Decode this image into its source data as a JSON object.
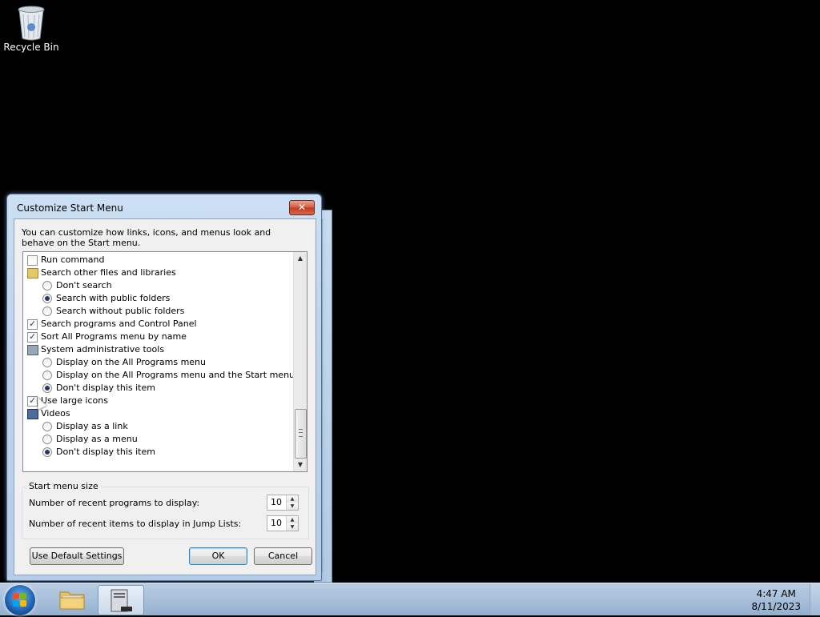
{
  "desktop": {
    "recycle_bin_label": "Recycle Bin"
  },
  "dialog": {
    "title": "Customize Start Menu",
    "close_label": "✕",
    "description": "You can customize how links, icons, and menus look and behave on the Start menu.",
    "items": [
      {
        "kind": "checkbox",
        "label": "Run command",
        "checked": false
      },
      {
        "kind": "group",
        "label": "Search other files and libraries",
        "icon": "folder-search-icon"
      },
      {
        "kind": "radio",
        "label": "Don't search",
        "selected": false
      },
      {
        "kind": "radio",
        "label": "Search with public folders",
        "selected": true
      },
      {
        "kind": "radio",
        "label": "Search without public folders",
        "selected": false
      },
      {
        "kind": "checkbox",
        "label": "Search programs and Control Panel",
        "checked": true
      },
      {
        "kind": "checkbox",
        "label": "Sort All Programs menu by name",
        "checked": true
      },
      {
        "kind": "group",
        "label": "System administrative tools",
        "icon": "admin-tools-icon"
      },
      {
        "kind": "radio",
        "label": "Display on the All Programs menu",
        "selected": false
      },
      {
        "kind": "radio",
        "label": "Display on the All Programs menu and the Start menu",
        "selected": false
      },
      {
        "kind": "radio",
        "label": "Don't display this item",
        "selected": true
      },
      {
        "kind": "checkbox",
        "label": "Use large icons",
        "checked": true
      },
      {
        "kind": "group",
        "label": "Videos",
        "icon": "videos-icon"
      },
      {
        "kind": "radio",
        "label": "Display as a link",
        "selected": false
      },
      {
        "kind": "radio",
        "label": "Display as a menu",
        "selected": false
      },
      {
        "kind": "radio",
        "label": "Don't display this item",
        "selected": true
      }
    ],
    "start_menu_size": {
      "legend": "Start menu size",
      "recent_programs_label": "Number of recent programs to display:",
      "recent_programs_value": "10",
      "jump_list_label": "Number of recent items to display in Jump Lists:",
      "jump_list_value": "10"
    },
    "buttons": {
      "defaults": "Use Default Settings",
      "ok": "OK",
      "cancel": "Cancel"
    }
  },
  "taskbar": {
    "time": "4:47 AM",
    "date": "8/11/2023"
  }
}
